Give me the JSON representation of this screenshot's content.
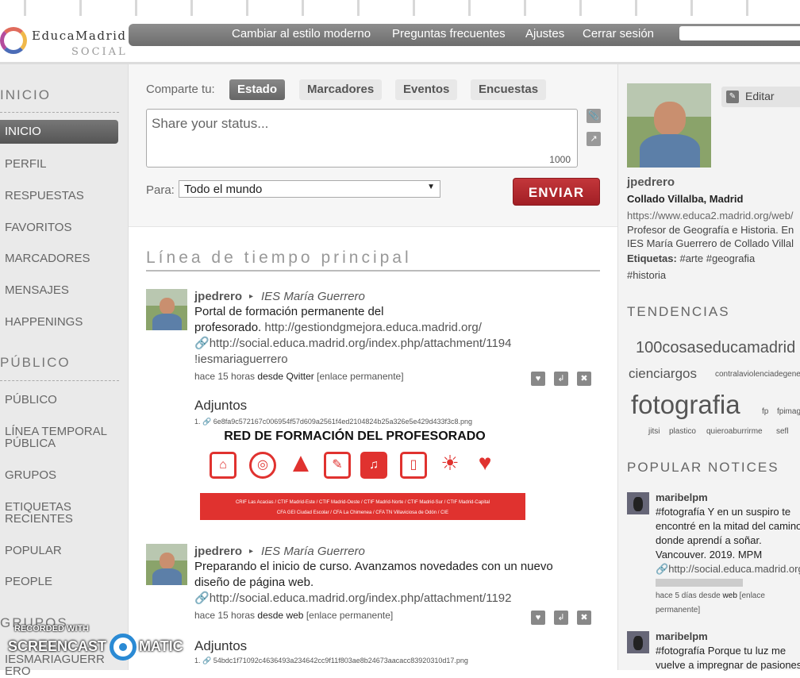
{
  "header": {
    "logo_name": "EducaMadrid",
    "logo_sub": "SOCIAL",
    "links": [
      "Cambiar al estilo moderno",
      "Preguntas frecuentes",
      "Ajustes",
      "Cerrar sesión"
    ]
  },
  "sidebar": {
    "sections": {
      "inicio": "INICIO",
      "publico": "PÚBLICO",
      "grupos": "GRUPOS"
    },
    "inicio_items": [
      "INICIO",
      "PERFIL",
      "RESPUESTAS",
      "FAVORITOS",
      "MARCADORES",
      "MENSAJES",
      "HAPPENINGS"
    ],
    "publico_items": [
      "PÚBLICO",
      "LÍNEA TEMPORAL PÚBLICA",
      "GRUPOS",
      "ETIQUETAS RECIENTES",
      "POPULAR",
      "PEOPLE"
    ],
    "grupos_items": [
      "IESMARIAGUERR ERO"
    ]
  },
  "share": {
    "label": "Comparte tu:",
    "tabs": [
      "Estado",
      "Marcadores",
      "Eventos",
      "Encuestas"
    ],
    "placeholder": "Share your status...",
    "counter": "1000",
    "para_label": "Para:",
    "para_value": "Todo el mundo",
    "send": "ENVIAR"
  },
  "timeline": {
    "title": "Línea de tiempo principal",
    "notices": [
      {
        "user": "jpedrero",
        "group": "IES María Guerrero",
        "text1": "Portal de formación permanente del",
        "text2": "profesorado.",
        "link1": "http://gestiondgmejora.educa.madrid.org/",
        "link2": "http://social.educa.madrid.org/index.php/attachment/1194",
        "group_tag": "!iesmariaguerrero",
        "time": "hace 15 horas",
        "from_label": "desde",
        "source": "Qvitter",
        "permalink": "[enlace permanente]",
        "attachments_title": "Adjuntos",
        "attachment_num": "1.",
        "attachment_file": "6e8fa9c572167c006954f57d609a2561f4ed2104824b25a326e5e429d433f3c8.png"
      },
      {
        "user": "jpedrero",
        "group": "IES María Guerrero",
        "text1": "Preparando el inicio de curso. Avanzamos novedades con un nuevo",
        "text2": "diseño de página web.",
        "link2": "http://social.educa.madrid.org/index.php/attachment/1192",
        "time": "hace 15 horas",
        "from_label": "desde",
        "source": "web",
        "permalink": "[enlace permanente]",
        "attachments_title": "Adjuntos",
        "attachment_num": "1.",
        "attachment_file": "54bdc1f71092c4636493a234642cc9f11f803ae8b24673aacacc83920310d17.png"
      }
    ],
    "banner": {
      "title": "RED DE FORMACIÓN DEL PROFESORADO",
      "footer1": "CRIF Las Acacias / CTIF Madrid-Este / CTIF Madrid-Oeste / CTIF Madrid-Norte / CTIF Madrid-Sur / CTIF Madrid-Capital",
      "footer2": "CFA GEI Ciudad Escolar / CFA La Chimenea / CFA TN Villaviciosa de Odón / CIE"
    }
  },
  "profile": {
    "edit": "Editar",
    "nick": "jpedrero",
    "location": "Collado Villalba, Madrid",
    "url": "https://www.educa2.madrid.org/web/",
    "bio1": "Profesor de Geografía e Historia. En",
    "bio2": "IES María Guerrero de Collado Villal",
    "tags_label": "Etiquetas:",
    "tags": [
      "#arte",
      "#geografia",
      "#historia"
    ]
  },
  "trends": {
    "title": "TENDENCIAS",
    "tags": [
      "100cosaseducamadrid",
      "cienciargos",
      "contralaviolenciadegenero",
      "fotografia",
      "fp",
      "fpimagen",
      "jitsi",
      "plastico",
      "quieroaburrirme",
      "sefl"
    ]
  },
  "popular": {
    "title": "POPULAR NOTICES",
    "items": [
      {
        "user": "maribelpm",
        "lines": [
          "#fotografía Y en un suspiro te",
          "encontré en la mitad del camino",
          "donde aprendí a soñar.",
          "Vancouver. 2019. MPM",
          "http://social.educa.madrid.org"
        ],
        "time": "hace 5 días",
        "from_label": "desde",
        "source": "web",
        "permalink": "[enlace",
        "permalink2": "permanente]"
      },
      {
        "user": "maribelpm",
        "lines": [
          "#fotografía Porque tu luz me",
          "vuelve a impregnar de pasiones"
        ]
      }
    ]
  },
  "watermark": {
    "line1": "RECORDED WITH",
    "line2a": "SCREENCAST",
    "line2b": "MATIC"
  }
}
